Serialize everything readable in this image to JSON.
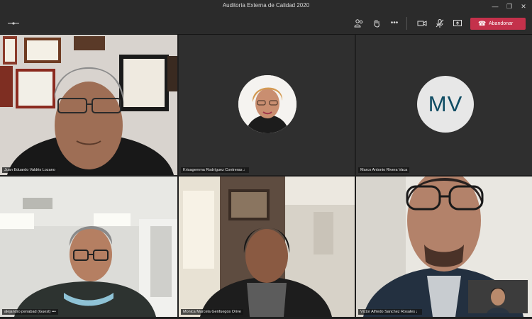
{
  "window": {
    "title": "Auditoría Externa de Calidad 2020"
  },
  "toolbar": {
    "leave_label": "Abandonar"
  },
  "participants": [
    {
      "name": "Juan Eduardo Valdés Lozano"
    },
    {
      "name": "Krisagemma Rodríguez Contreras"
    },
    {
      "name": "Marco Antonio Rivera Vaca",
      "initials": "MV"
    },
    {
      "name": "alejandro penabad (Guest)"
    },
    {
      "name": "Monica Marcela Genfuegos Orive"
    },
    {
      "name": "Victor Alfredo Sanchez Rosales"
    }
  ],
  "colors": {
    "leave_button": "#c4314b",
    "window_chrome": "#2b2b2b",
    "avatar_initials": "#0f4c63"
  }
}
